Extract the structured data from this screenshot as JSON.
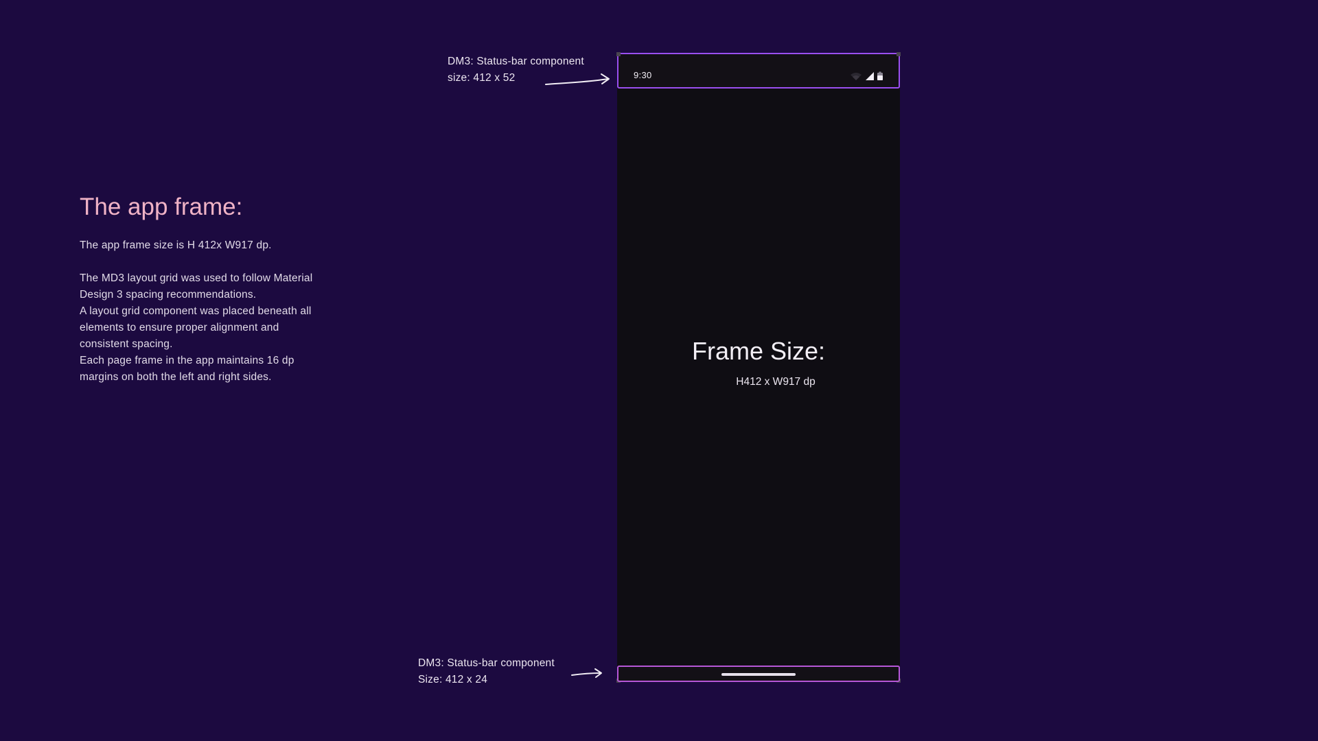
{
  "left_panel": {
    "title": "The app frame:",
    "size_line": "The app frame size is H 412x W917 dp.",
    "para_lines": [
      "The MD3 layout grid was used to follow Material",
      "Design 3 spacing recommendations.",
      "A layout grid component was placed beneath all",
      "elements to ensure proper alignment and",
      "consistent spacing.",
      "Each page frame in the app maintains 16 dp",
      "margins on both the left and right sides."
    ]
  },
  "annotations": {
    "top_line1": "DM3: Status-bar component",
    "top_line2": "size: 412 x 52",
    "bottom_line1": "DM3: Status-bar component",
    "bottom_line2": "Size: 412 x 24"
  },
  "phone": {
    "status_time": "9:30",
    "frame_title": "Frame Size:",
    "frame_subtitle": "H412 x W917 dp",
    "status_icons": [
      "wifi-icon",
      "signal-icon",
      "battery-icon"
    ]
  },
  "colors": {
    "background": "#1c0a40",
    "title_pink": "#f0b3c6",
    "phone_bg": "#0f0d13",
    "status_border": "#9a4ff0",
    "nav_border": "#b757d8"
  }
}
